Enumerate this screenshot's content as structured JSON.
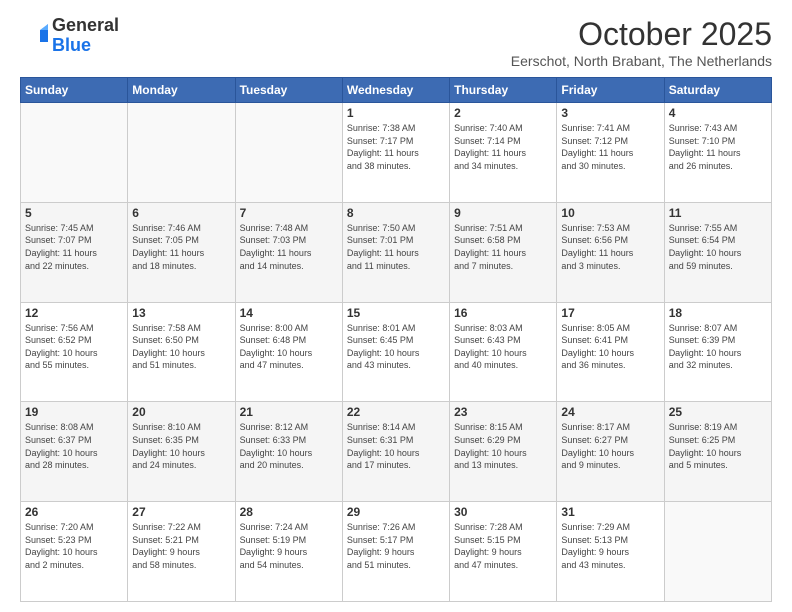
{
  "logo": {
    "general": "General",
    "blue": "Blue"
  },
  "header": {
    "month": "October 2025",
    "location": "Eerschot, North Brabant, The Netherlands"
  },
  "days_of_week": [
    "Sunday",
    "Monday",
    "Tuesday",
    "Wednesday",
    "Thursday",
    "Friday",
    "Saturday"
  ],
  "weeks": [
    [
      {
        "day": "",
        "info": ""
      },
      {
        "day": "",
        "info": ""
      },
      {
        "day": "",
        "info": ""
      },
      {
        "day": "1",
        "info": "Sunrise: 7:38 AM\nSunset: 7:17 PM\nDaylight: 11 hours\nand 38 minutes."
      },
      {
        "day": "2",
        "info": "Sunrise: 7:40 AM\nSunset: 7:14 PM\nDaylight: 11 hours\nand 34 minutes."
      },
      {
        "day": "3",
        "info": "Sunrise: 7:41 AM\nSunset: 7:12 PM\nDaylight: 11 hours\nand 30 minutes."
      },
      {
        "day": "4",
        "info": "Sunrise: 7:43 AM\nSunset: 7:10 PM\nDaylight: 11 hours\nand 26 minutes."
      }
    ],
    [
      {
        "day": "5",
        "info": "Sunrise: 7:45 AM\nSunset: 7:07 PM\nDaylight: 11 hours\nand 22 minutes."
      },
      {
        "day": "6",
        "info": "Sunrise: 7:46 AM\nSunset: 7:05 PM\nDaylight: 11 hours\nand 18 minutes."
      },
      {
        "day": "7",
        "info": "Sunrise: 7:48 AM\nSunset: 7:03 PM\nDaylight: 11 hours\nand 14 minutes."
      },
      {
        "day": "8",
        "info": "Sunrise: 7:50 AM\nSunset: 7:01 PM\nDaylight: 11 hours\nand 11 minutes."
      },
      {
        "day": "9",
        "info": "Sunrise: 7:51 AM\nSunset: 6:58 PM\nDaylight: 11 hours\nand 7 minutes."
      },
      {
        "day": "10",
        "info": "Sunrise: 7:53 AM\nSunset: 6:56 PM\nDaylight: 11 hours\nand 3 minutes."
      },
      {
        "day": "11",
        "info": "Sunrise: 7:55 AM\nSunset: 6:54 PM\nDaylight: 10 hours\nand 59 minutes."
      }
    ],
    [
      {
        "day": "12",
        "info": "Sunrise: 7:56 AM\nSunset: 6:52 PM\nDaylight: 10 hours\nand 55 minutes."
      },
      {
        "day": "13",
        "info": "Sunrise: 7:58 AM\nSunset: 6:50 PM\nDaylight: 10 hours\nand 51 minutes."
      },
      {
        "day": "14",
        "info": "Sunrise: 8:00 AM\nSunset: 6:48 PM\nDaylight: 10 hours\nand 47 minutes."
      },
      {
        "day": "15",
        "info": "Sunrise: 8:01 AM\nSunset: 6:45 PM\nDaylight: 10 hours\nand 43 minutes."
      },
      {
        "day": "16",
        "info": "Sunrise: 8:03 AM\nSunset: 6:43 PM\nDaylight: 10 hours\nand 40 minutes."
      },
      {
        "day": "17",
        "info": "Sunrise: 8:05 AM\nSunset: 6:41 PM\nDaylight: 10 hours\nand 36 minutes."
      },
      {
        "day": "18",
        "info": "Sunrise: 8:07 AM\nSunset: 6:39 PM\nDaylight: 10 hours\nand 32 minutes."
      }
    ],
    [
      {
        "day": "19",
        "info": "Sunrise: 8:08 AM\nSunset: 6:37 PM\nDaylight: 10 hours\nand 28 minutes."
      },
      {
        "day": "20",
        "info": "Sunrise: 8:10 AM\nSunset: 6:35 PM\nDaylight: 10 hours\nand 24 minutes."
      },
      {
        "day": "21",
        "info": "Sunrise: 8:12 AM\nSunset: 6:33 PM\nDaylight: 10 hours\nand 20 minutes."
      },
      {
        "day": "22",
        "info": "Sunrise: 8:14 AM\nSunset: 6:31 PM\nDaylight: 10 hours\nand 17 minutes."
      },
      {
        "day": "23",
        "info": "Sunrise: 8:15 AM\nSunset: 6:29 PM\nDaylight: 10 hours\nand 13 minutes."
      },
      {
        "day": "24",
        "info": "Sunrise: 8:17 AM\nSunset: 6:27 PM\nDaylight: 10 hours\nand 9 minutes."
      },
      {
        "day": "25",
        "info": "Sunrise: 8:19 AM\nSunset: 6:25 PM\nDaylight: 10 hours\nand 5 minutes."
      }
    ],
    [
      {
        "day": "26",
        "info": "Sunrise: 7:20 AM\nSunset: 5:23 PM\nDaylight: 10 hours\nand 2 minutes."
      },
      {
        "day": "27",
        "info": "Sunrise: 7:22 AM\nSunset: 5:21 PM\nDaylight: 9 hours\nand 58 minutes."
      },
      {
        "day": "28",
        "info": "Sunrise: 7:24 AM\nSunset: 5:19 PM\nDaylight: 9 hours\nand 54 minutes."
      },
      {
        "day": "29",
        "info": "Sunrise: 7:26 AM\nSunset: 5:17 PM\nDaylight: 9 hours\nand 51 minutes."
      },
      {
        "day": "30",
        "info": "Sunrise: 7:28 AM\nSunset: 5:15 PM\nDaylight: 9 hours\nand 47 minutes."
      },
      {
        "day": "31",
        "info": "Sunrise: 7:29 AM\nSunset: 5:13 PM\nDaylight: 9 hours\nand 43 minutes."
      },
      {
        "day": "",
        "info": ""
      }
    ]
  ]
}
